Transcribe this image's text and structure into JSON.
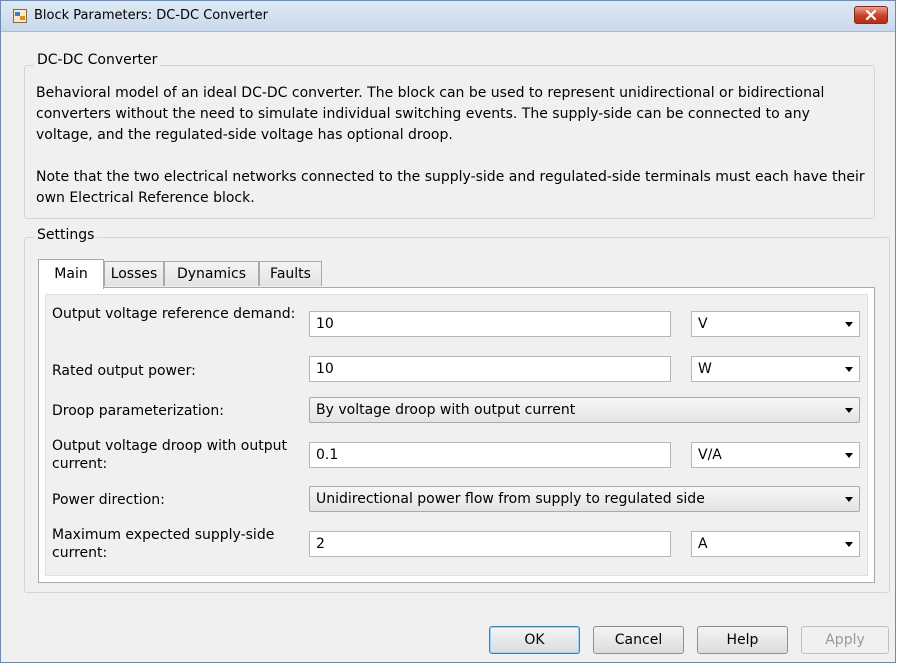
{
  "window": {
    "title": "Block Parameters: DC-DC Converter"
  },
  "block": {
    "name": "DC-DC Converter",
    "description": "Behavioral model of an ideal DC-DC converter. The block can be used to represent unidirectional or bidirectional converters without the need to simulate individual switching events. The supply-side can be connected to any voltage, and the regulated-side voltage has optional droop.",
    "note": "Note that the two electrical networks connected to the supply-side and regulated-side terminals must each have their own Electrical Reference block."
  },
  "settings": {
    "label": "Settings",
    "tabs": [
      {
        "label": "Main",
        "active": true
      },
      {
        "label": "Losses",
        "active": false
      },
      {
        "label": "Dynamics",
        "active": false
      },
      {
        "label": "Faults",
        "active": false
      }
    ],
    "params": [
      {
        "label": "Output voltage reference demand:",
        "value": "10",
        "unit": "V"
      },
      {
        "label": "Rated output power:",
        "value": "10",
        "unit": "W"
      },
      {
        "label": "Droop parameterization:",
        "selected": "By voltage droop with output current"
      },
      {
        "label": "Output voltage droop with output current:",
        "value": "0.1",
        "unit": "V/A"
      },
      {
        "label": "Power direction:",
        "selected": "Unidirectional power flow from supply to regulated side"
      },
      {
        "label": "Maximum expected supply-side current:",
        "value": "2",
        "unit": "A"
      }
    ]
  },
  "buttons": {
    "ok": "OK",
    "cancel": "Cancel",
    "help": "Help",
    "apply": "Apply"
  },
  "colors": {
    "close_button": "#c7402a",
    "ok_button_border": "#3c7fb1",
    "disabled_text": "#9a9a9a"
  }
}
